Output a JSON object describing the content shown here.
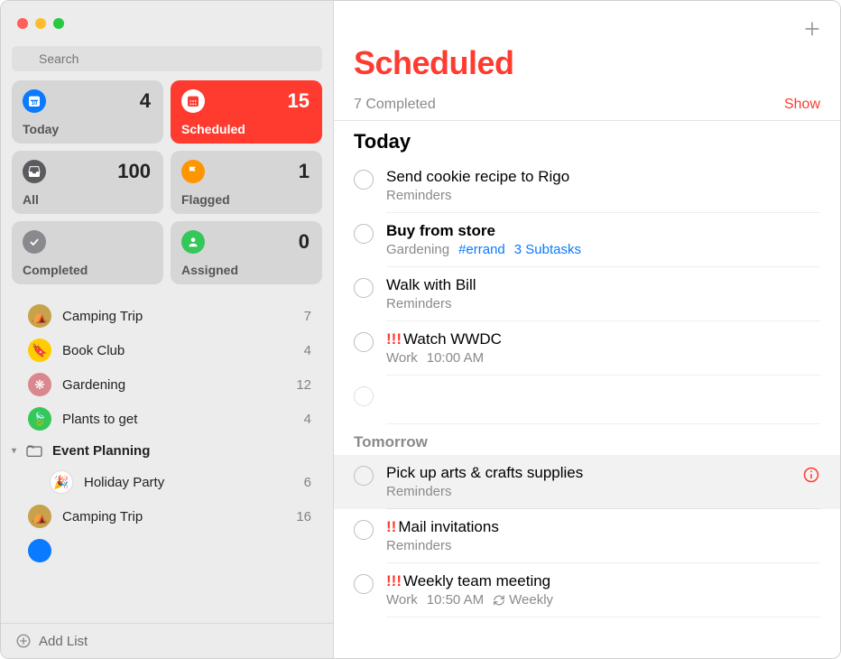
{
  "search": {
    "placeholder": "Search"
  },
  "smart": {
    "today": {
      "label": "Today",
      "count": "4",
      "icon_bg": "#0a7aff"
    },
    "scheduled": {
      "label": "Scheduled",
      "count": "15",
      "icon_bg": "#ffffff"
    },
    "all": {
      "label": "All",
      "count": "100",
      "icon_bg": "#5b5b5f"
    },
    "flagged": {
      "label": "Flagged",
      "count": "1",
      "icon_bg": "#ff9500"
    },
    "completed": {
      "label": "Completed",
      "count": "",
      "icon_bg": "#8a8a8e"
    },
    "assigned": {
      "label": "Assigned",
      "count": "0",
      "icon_bg": "#34c759"
    }
  },
  "lists": {
    "items": [
      {
        "name": "Camping Trip",
        "count": "7",
        "color": "#c7a24a",
        "emoji": "⛺"
      },
      {
        "name": "Book Club",
        "count": "4",
        "color": "#ffcc00",
        "emoji": "🔖"
      },
      {
        "name": "Gardening",
        "count": "12",
        "color": "#d98890",
        "emoji": "❋"
      },
      {
        "name": "Plants to get",
        "count": "4",
        "color": "#34c759",
        "emoji": "🍃"
      }
    ],
    "group": {
      "name": "Event Planning",
      "children": [
        {
          "name": "Holiday Party",
          "count": "6",
          "emoji": "🎉",
          "color": "#ffffff"
        },
        {
          "name": "Camping Trip",
          "count": "16",
          "emoji": "⛺",
          "color": "#c7a24a"
        }
      ]
    }
  },
  "add_list_label": "Add List",
  "main": {
    "title": "Scheduled",
    "completed_summary": "7 Completed",
    "show_label": "Show",
    "sections": {
      "today": {
        "header": "Today",
        "tasks": [
          {
            "title": "Send cookie recipe to Rigo",
            "list": "Reminders"
          },
          {
            "title": "Buy from store",
            "bold": true,
            "list": "Gardening",
            "tag": "#errand",
            "subtasks": "3 Subtasks"
          },
          {
            "title": "Walk with Bill",
            "list": "Reminders"
          },
          {
            "priority": "!!!",
            "title": "Watch WWDC",
            "list": "Work",
            "time": "10:00 AM"
          }
        ]
      },
      "tomorrow": {
        "header": "Tomorrow",
        "tasks": [
          {
            "title": "Pick up arts & crafts supplies",
            "list": "Reminders",
            "selected": true
          },
          {
            "priority": "!!",
            "title": "Mail invitations",
            "list": "Reminders"
          },
          {
            "priority": "!!!",
            "title": "Weekly team meeting",
            "list": "Work",
            "time": "10:50 AM",
            "repeat": "Weekly"
          }
        ]
      }
    }
  }
}
